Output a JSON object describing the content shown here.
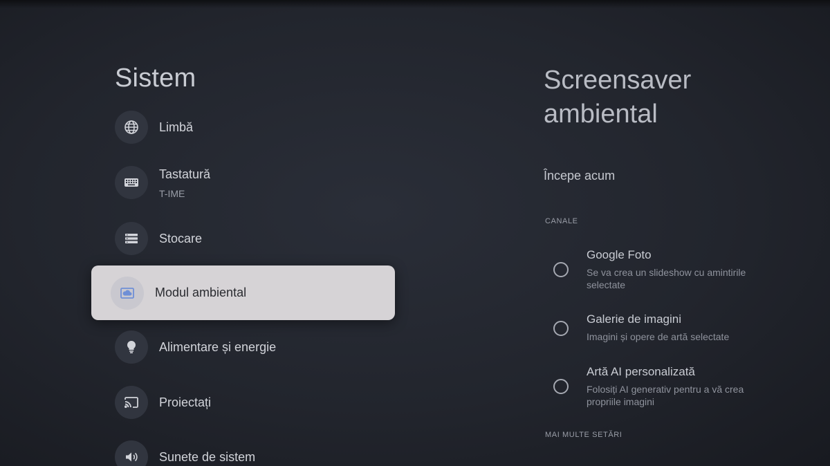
{
  "left_panel": {
    "title": "Sistem",
    "items": [
      {
        "label": "Limbă",
        "icon": "globe-icon"
      },
      {
        "label": "Tastatură",
        "sublabel": "T-IME",
        "icon": "keyboard-icon"
      },
      {
        "label": "Stocare",
        "icon": "storage-icon"
      },
      {
        "label": "Modul ambiental",
        "icon": "ambient-mode-icon",
        "selected": true
      },
      {
        "label": "Alimentare și energie",
        "icon": "lightbulb-icon"
      },
      {
        "label": "Proiectați",
        "icon": "cast-icon"
      },
      {
        "label": "Sunete de sistem",
        "icon": "volume-icon"
      }
    ]
  },
  "right_panel": {
    "title": "Screensaver ambiental",
    "start_now": "Începe acum",
    "channels_header": "CANALE",
    "options": [
      {
        "title": "Google Foto",
        "description": "Se va crea un slideshow cu amintirile selectate"
      },
      {
        "title": "Galerie de imagini",
        "description": "Imagini și opere de artă selectate"
      },
      {
        "title": "Artă AI personalizată",
        "description": "Folosiți AI generativ pentru a vă crea propriile imagini"
      }
    ],
    "more_settings_header": "MAI MULTE SETĂRI"
  },
  "colors": {
    "background": "#22252d",
    "selected_item_bg": "#d6d3d6",
    "icon_accent": "#7c99d8"
  }
}
